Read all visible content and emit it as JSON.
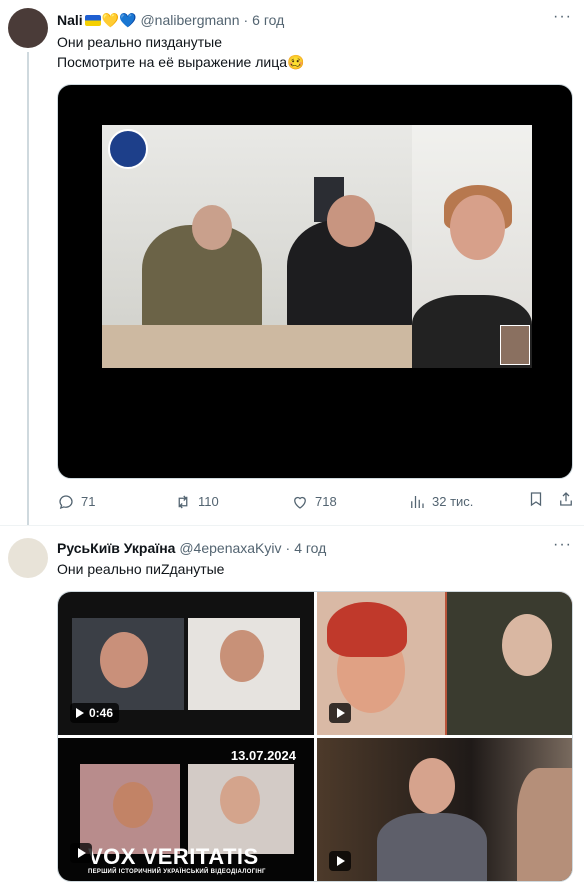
{
  "tweets": [
    {
      "author_name": "Nali",
      "author_emoji": "💛💙",
      "handle": "@nalibergmann",
      "separator": "·",
      "time": "6 год",
      "text_line1": "Они реально пизданутые",
      "text_line2": "Посмотрите на её выражение лица🥴",
      "more": "···",
      "actions": {
        "replies": "71",
        "retweets": "110",
        "likes": "718",
        "views": "32 тис."
      }
    },
    {
      "author_name": "РусьКиїв Україна",
      "handle": "@4epenaxaKyiv",
      "separator": "·",
      "time": "4 год",
      "text_line1": "Они реально пиZданутые",
      "more": "···",
      "media": {
        "video1_duration": "0:46",
        "vox_date": "13.07.2024",
        "vox_title": "VOX VERITATIS",
        "vox_subtitle": "ПЕРШИЙ ІСТОРИЧНИЙ УКРАЇНСЬКИЙ ВІДЕОДІАЛОГІНГ"
      }
    }
  ],
  "colors": {
    "text_primary": "#0f1419",
    "text_secondary": "#536471",
    "border": "#cfd9de"
  },
  "icons": [
    "reply-icon",
    "retweet-icon",
    "like-icon",
    "views-icon",
    "bookmark-icon",
    "share-icon",
    "more-icon",
    "play-icon"
  ]
}
